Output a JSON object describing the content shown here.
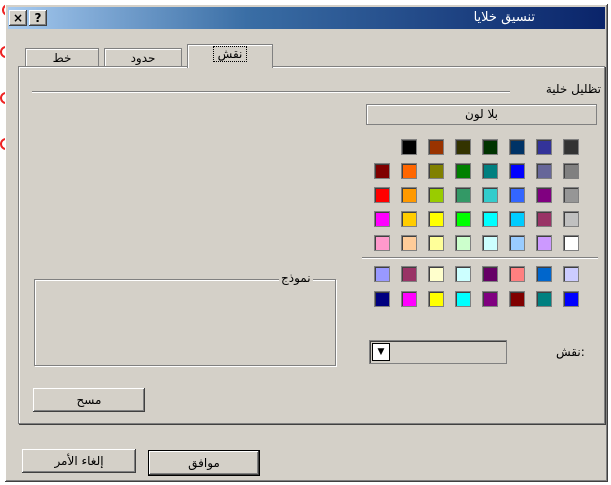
{
  "window": {
    "title": "تنسيق خلايا",
    "help_button": "?",
    "close_button": "×"
  },
  "tabs": [
    {
      "label": "نقش",
      "active": true
    },
    {
      "label": "حدود",
      "active": false
    },
    {
      "label": "خط",
      "active": false
    }
  ],
  "shading": {
    "group_label": "تظليل خلية",
    "no_color_button": "بلا لون",
    "palette_top": [
      [
        "#333333",
        "#333399",
        "#003366",
        "#003300",
        "#333300",
        "#993300",
        "#000000"
      ],
      [
        "#808080",
        "#666699",
        "#0000ff",
        "#008080",
        "#008000",
        "#808000",
        "#ff6600",
        "#800000"
      ],
      [
        "#969696",
        "#800080",
        "#3366ff",
        "#33cccc",
        "#339966",
        "#99cc00",
        "#ff9900",
        "#ff0000"
      ],
      [
        "#c0c0c0",
        "#993366",
        "#00ccff",
        "#00ffff",
        "#00ff00",
        "#ffff00",
        "#ffcc00",
        "#ff00ff"
      ],
      [
        "#ffffff",
        "#cc99ff",
        "#99ccff",
        "#ccffff",
        "#ccffcc",
        "#ffff99",
        "#ffcc99",
        "#ff99cc"
      ]
    ],
    "palette_bottom": [
      [
        "#ccccff",
        "#0066cc",
        "#ff8080",
        "#660066",
        "#ccffff",
        "#ffffcc",
        "#993366",
        "#9999ff"
      ],
      [
        "#0000ff",
        "#008080",
        "#800000",
        "#800080",
        "#00ffff",
        "#ffff00",
        "#ff00ff",
        "#000080"
      ]
    ]
  },
  "sample": {
    "label": "نموذج"
  },
  "pattern": {
    "label": "نقش:"
  },
  "buttons": {
    "clear": "مسح",
    "ok": "موافق",
    "cancel": "إلغاء الأمر"
  }
}
